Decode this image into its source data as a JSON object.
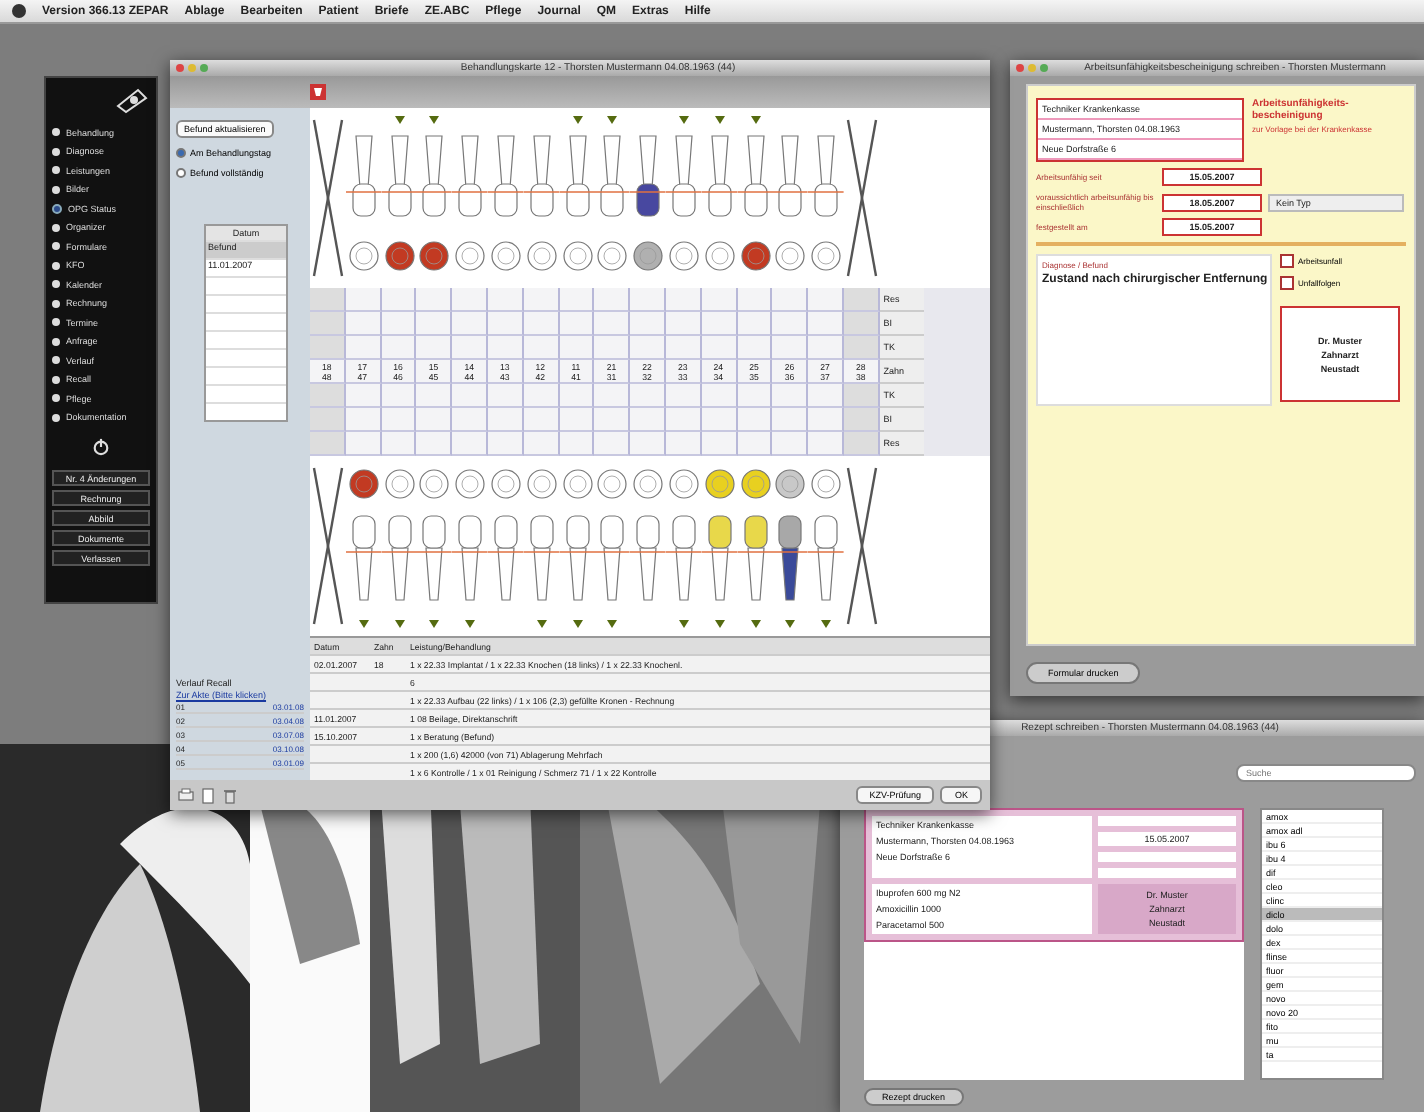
{
  "menu_bar": {
    "items": [
      "Version 366.13 ZEPAR",
      "Ablage",
      "Bearbeiten",
      "Patient",
      "Briefe",
      "ZE.ABC",
      "Pflege",
      "Journal",
      "QM",
      "Extras",
      "Hilfe"
    ]
  },
  "sidebar": {
    "items": [
      {
        "label": "Behandlung",
        "selected": false
      },
      {
        "label": "Diagnose",
        "selected": false
      },
      {
        "label": "Leistungen",
        "selected": false
      },
      {
        "label": "Bilder",
        "selected": false
      },
      {
        "label": "OPG Status",
        "selected": true
      },
      {
        "label": "Organizer",
        "selected": false
      },
      {
        "label": "Formulare",
        "selected": false
      },
      {
        "label": "KFO",
        "selected": false
      },
      {
        "label": "Kalender",
        "selected": false
      },
      {
        "label": "Rechnung",
        "selected": false
      },
      {
        "label": "Termine",
        "selected": false
      },
      {
        "label": "Anfrage",
        "selected": false
      },
      {
        "label": "Verlauf",
        "selected": false
      },
      {
        "label": "Recall",
        "selected": false
      },
      {
        "label": "Pflege",
        "selected": false
      },
      {
        "label": "Dokumentation",
        "selected": false
      }
    ],
    "buttons": [
      "Nr. 4 Änderungen",
      "Rechnung",
      "Abbild",
      "Dokumente",
      "Verlassen"
    ]
  },
  "chart_window": {
    "title": "Behandlungskarte 12 - Thorsten Mustermann 04.08.1963 (44)",
    "refresh_button": "Befund aktualisieren",
    "radios": [
      {
        "label": "Am Behandlungstag",
        "selected": true
      },
      {
        "label": "Befund vollständig",
        "selected": false
      }
    ],
    "dates": {
      "header": "Datum",
      "rows": [
        "Befund",
        "11.01.2007"
      ]
    },
    "upper_teeth": [
      {
        "number": "18",
        "kind": "missing",
        "marked": false
      },
      {
        "number": "17",
        "kind": "healthy",
        "marked": false
      },
      {
        "number": "16",
        "kind": "filling",
        "marked": true
      },
      {
        "number": "15",
        "kind": "filling",
        "marked": true
      },
      {
        "number": "14",
        "kind": "healthy",
        "marked": false
      },
      {
        "number": "13",
        "kind": "healthy",
        "marked": false
      },
      {
        "number": "12",
        "kind": "healthy",
        "marked": false
      },
      {
        "number": "11",
        "kind": "healthy",
        "marked": true
      },
      {
        "number": "21",
        "kind": "healthy",
        "marked": true
      },
      {
        "number": "22",
        "kind": "crown",
        "marked": false
      },
      {
        "number": "23",
        "kind": "healthy",
        "marked": true
      },
      {
        "number": "24",
        "kind": "healthy",
        "marked": true
      },
      {
        "number": "25",
        "kind": "filling",
        "marked": true
      },
      {
        "number": "26",
        "kind": "healthy",
        "marked": false
      },
      {
        "number": "27",
        "kind": "healthy",
        "marked": false
      },
      {
        "number": "28",
        "kind": "missing",
        "marked": false
      }
    ],
    "row_labels": [
      "Res",
      "BI",
      "TK",
      "Zahn",
      "TK",
      "BI",
      "Res"
    ],
    "lower_teeth": [
      {
        "number": "48",
        "kind": "missing",
        "marked": false
      },
      {
        "number": "47",
        "kind": "filling",
        "marked": true
      },
      {
        "number": "46",
        "kind": "healthy",
        "marked": true
      },
      {
        "number": "45",
        "kind": "healthy",
        "marked": true
      },
      {
        "number": "44",
        "kind": "healthy",
        "marked": true
      },
      {
        "number": "43",
        "kind": "healthy",
        "marked": false
      },
      {
        "number": "42",
        "kind": "healthy",
        "marked": true
      },
      {
        "number": "41",
        "kind": "healthy",
        "marked": true
      },
      {
        "number": "31",
        "kind": "healthy",
        "marked": true
      },
      {
        "number": "32",
        "kind": "healthy",
        "marked": false
      },
      {
        "number": "33",
        "kind": "healthy",
        "marked": true
      },
      {
        "number": "34",
        "kind": "gold",
        "marked": true
      },
      {
        "number": "35",
        "kind": "gold",
        "marked": true
      },
      {
        "number": "36",
        "kind": "implant",
        "marked": true
      },
      {
        "number": "37",
        "kind": "healthy",
        "marked": true
      },
      {
        "number": "38",
        "kind": "missing",
        "marked": false
      }
    ],
    "list": {
      "columns": [
        "Datum",
        "Zahn",
        "Leistung/Behandlung"
      ],
      "rows": [
        {
          "date": "02.01.2007",
          "tooth": "18",
          "text": "1 x 22.33 Implantat / 1 x 22.33 Knochen (18 links) / 1 x 22.33 Knochenl."
        },
        {
          "date": "",
          "tooth": "",
          "text": "6"
        },
        {
          "date": "",
          "tooth": "",
          "text": "1 x 22.33 Aufbau (22 links) / 1 x 106 (2,3) gefüllte Kronen - Rechnung"
        },
        {
          "date": "11.01.2007",
          "tooth": "",
          "text": "1 08 Beilage, Direktanschrift"
        },
        {
          "date": "15.10.2007",
          "tooth": "",
          "text": "1 x Beratung (Befund)"
        },
        {
          "date": "",
          "tooth": "",
          "text": "1 x 200 (1,6) 42000 (von 71) Ablagerung Mehrfach"
        },
        {
          "date": "",
          "tooth": "",
          "text": "1 x 6 Kontrolle / 1 x 01 Reinigung / Schmerz 71 / 1 x 22 Kontrolle"
        }
      ]
    },
    "recall": {
      "title": "Verlauf Recall",
      "link": "Zur Akte (Bitte klicken)",
      "rows": [
        {
          "label": "01",
          "value": "03.01.08"
        },
        {
          "label": "02",
          "value": "03.04.08"
        },
        {
          "label": "03",
          "value": "03.07.08"
        },
        {
          "label": "04",
          "value": "03.10.08"
        },
        {
          "label": "05",
          "value": "03.01.09"
        }
      ]
    },
    "buttons": [
      "KZV-Prüfung",
      "OK"
    ]
  },
  "form_window": {
    "title": "Arbeitsunfähigkeitsbescheinigung schreiben - Thorsten Mustermann",
    "insurer": "Techniker Krankenkasse",
    "patient": "Mustermann, Thorsten 04.08.1963",
    "address": "Neue Dorfstraße 6",
    "heading": "Arbeitsunfähigkeits-bescheinigung",
    "subheading": "zur Vorlage bei der Krankenkasse",
    "dates": [
      {
        "label": "Arbeitsunfähig seit",
        "value": "15.05.2007"
      },
      {
        "label": "voraussichtlich arbeitsunfähig bis einschließlich",
        "value": "18.05.2007"
      },
      {
        "label": "festgestellt am",
        "value": "15.05.2007"
      }
    ],
    "type_select": "Kein Typ",
    "diagnosis_label": "Diagnose / Befund",
    "diagnosis": "Zustand nach chirurgischer Entfernung",
    "options": [
      {
        "label": "Arbeitsunfall",
        "checked": false
      },
      {
        "label": "Unfallfolgen",
        "checked": false
      }
    ],
    "stamp": [
      "Dr. Muster",
      "Zahnarzt",
      "Neustadt"
    ],
    "print_button": "Formular drucken"
  },
  "rx_window": {
    "title": "Rezept schreiben - Thorsten Mustermann 04.08.1963 (44)",
    "search": {
      "placeholder": "Suche"
    },
    "insurer": "Techniker Krankenkasse",
    "patient": "Mustermann, Thorsten 04.08.1963",
    "address": "Neue Dorfstraße 6",
    "drugs": [
      "Ibuprofen 600 mg N2",
      "Amoxicillin 1000",
      "Paracetamol 500"
    ],
    "stamp": [
      "Dr. Muster",
      "Zahnarzt",
      "Neustadt"
    ],
    "date": "15.05.2007",
    "list": [
      {
        "label": "amox",
        "selected": false
      },
      {
        "label": "amox adl",
        "selected": false
      },
      {
        "label": "ibu 6",
        "selected": false
      },
      {
        "label": "ibu 4",
        "selected": false
      },
      {
        "label": "dif",
        "selected": false
      },
      {
        "label": "cleo",
        "selected": false
      },
      {
        "label": "clinc",
        "selected": false
      },
      {
        "label": "diclo",
        "selected": true
      },
      {
        "label": "dolo",
        "selected": false
      },
      {
        "label": "dex",
        "selected": false
      },
      {
        "label": "flinse",
        "selected": false
      },
      {
        "label": "fluor",
        "selected": false
      },
      {
        "label": "gem",
        "selected": false
      },
      {
        "label": "novo",
        "selected": false
      },
      {
        "label": "novo 20",
        "selected": false
      },
      {
        "label": "fito",
        "selected": false
      },
      {
        "label": "mu",
        "selected": false
      },
      {
        "label": "ta",
        "selected": false
      }
    ],
    "print_button": "Rezept drucken"
  }
}
